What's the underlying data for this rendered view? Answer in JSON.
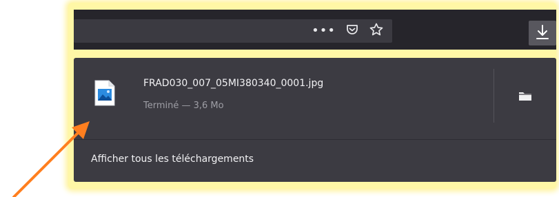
{
  "toolbar": {
    "page_actions_label": "•••",
    "pocket_icon": "pocket-icon",
    "bookmark_icon": "star-icon",
    "downloads_icon": "download-arrow-icon"
  },
  "downloads_panel": {
    "item": {
      "file_name": "FRAD030_007_05MI380340_0001.jpg",
      "status": "Terminé — 3,6 Mo",
      "file_type_icon": "image-file-icon",
      "open_folder_icon": "folder-icon"
    },
    "footer_label": "Afficher tous les téléchargements"
  },
  "annotation": {
    "arrow_color": "#ff7f1f",
    "frame_color": "#fff7a6"
  },
  "colors": {
    "toolbar_bg": "#26252b",
    "panel_bg": "#3c3b42",
    "text": "#f2f2f4",
    "muted_text": "#9e9ea5"
  }
}
